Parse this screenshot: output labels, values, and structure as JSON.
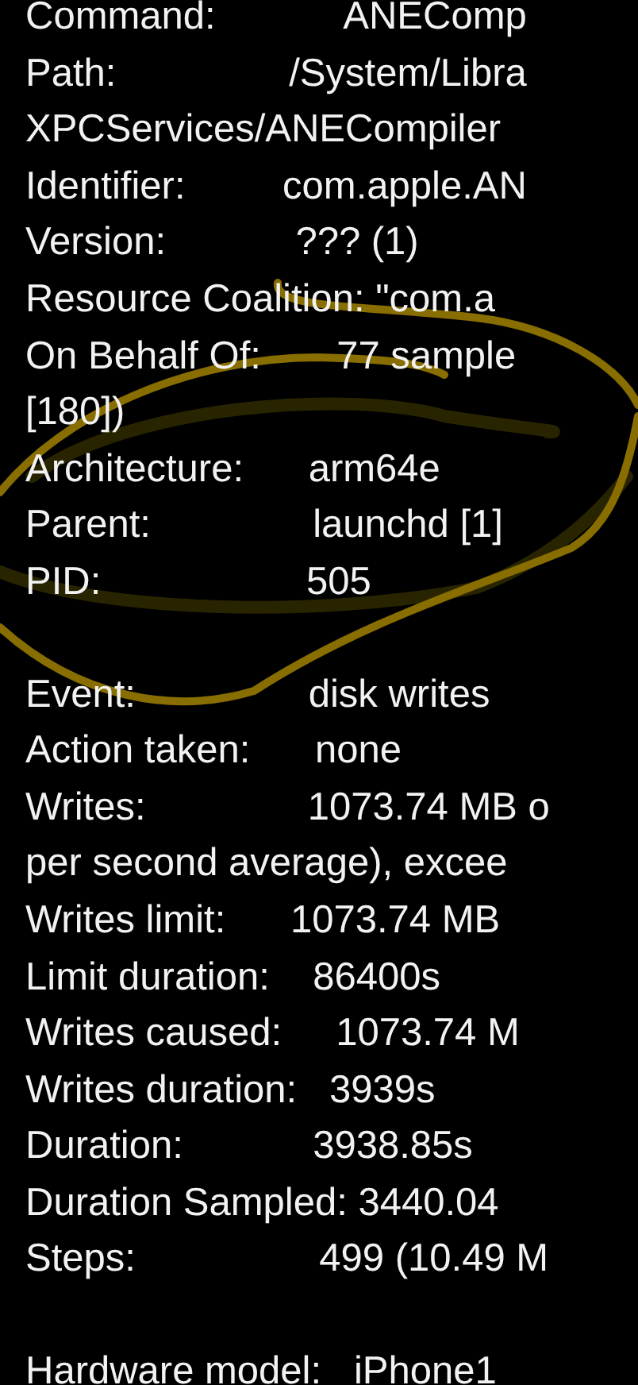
{
  "sections": [
    {
      "lines": [
        "Command:            ANEComp",
        "Path:                /System/Libra",
        "XPCServices/ANECompiler",
        "Identifier:         com.apple.AN",
        "Version:            ??? (1)",
        "Resource Coalition: \"com.a",
        "On Behalf Of:       77 sample",
        "[180])",
        "Architecture:      arm64e",
        "Parent:               launchd [1]",
        "PID:                   505"
      ]
    },
    {
      "lines": [
        "Event:                disk writes",
        "Action taken:      none",
        "Writes:               1073.74 MB o",
        "per second average), excee",
        "Writes limit:      1073.74 MB",
        "Limit duration:    86400s",
        "Writes caused:     1073.74 M",
        "Writes duration:   3939s",
        "Duration:            3938.85s",
        "Duration Sampled: 3440.04",
        "Steps:                 499 (10.49 M"
      ]
    },
    {
      "lines": [
        "Hardware model:   iPhone1"
      ]
    }
  ]
}
